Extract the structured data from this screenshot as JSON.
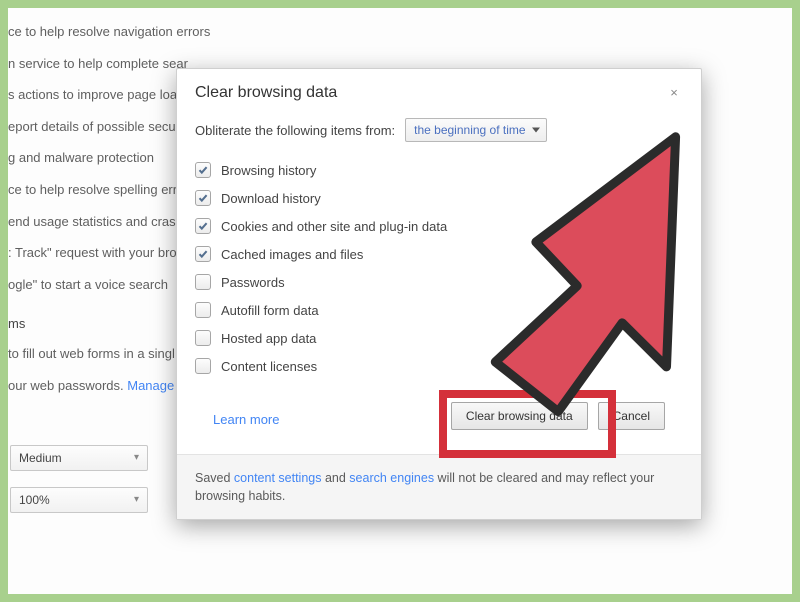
{
  "bg": {
    "lines": [
      "ce to help resolve navigation errors",
      "n service to help complete sear",
      "s actions to improve page load",
      "eport details of possible securi",
      "g and malware protection",
      "ce to help resolve spelling err",
      "end usage statistics and crash",
      ": Track\" request with your brow",
      "ogle\" to start a voice search"
    ],
    "section": "ms",
    "formLine": "to fill out web forms in a singl",
    "pwLine": "our web passwords.  ",
    "manage": "Manage s",
    "select1": "Medium",
    "select2": "100%"
  },
  "dialog": {
    "title": "Clear browsing data",
    "closeGlyph": "×",
    "prompt": "Obliterate the following items from:",
    "timeRange": "the beginning of time",
    "options": [
      {
        "label": "Browsing history",
        "checked": true
      },
      {
        "label": "Download history",
        "checked": true
      },
      {
        "label": "Cookies and other site and plug-in data",
        "checked": true
      },
      {
        "label": "Cached images and files",
        "checked": true
      },
      {
        "label": "Passwords",
        "checked": false
      },
      {
        "label": "Autofill form data",
        "checked": false
      },
      {
        "label": "Hosted app data",
        "checked": false
      },
      {
        "label": "Content licenses",
        "checked": false
      }
    ],
    "learnMore": "Learn more",
    "primary": "Clear browsing data",
    "cancel": "Cancel",
    "footer": {
      "pre": "Saved ",
      "link1": "content settings",
      "mid": "  and  ",
      "link2": "search engines",
      "post": "  will not be cleared and may reflect your browsing habits."
    }
  },
  "colors": {
    "highlight": "#d4303a",
    "arrowFill": "#dc4c5b",
    "arrowStroke": "#2b2b2b"
  }
}
